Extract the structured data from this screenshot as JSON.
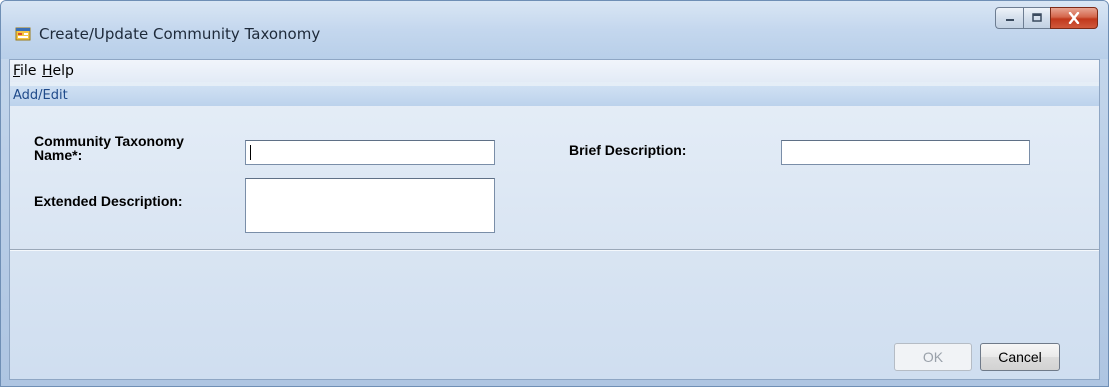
{
  "window": {
    "title": "Create/Update Community Taxonomy",
    "icon": "form-icon",
    "controls": {
      "minimize": "minimize-icon",
      "maximize": "maximize-icon",
      "close": "close-icon"
    }
  },
  "menu": {
    "file": {
      "underlined": "F",
      "rest": "ile"
    },
    "help": {
      "underlined": "H",
      "rest": "elp"
    }
  },
  "section": {
    "header": "Add/Edit"
  },
  "form": {
    "name_label_line1": "Community Taxonomy",
    "name_label_line2": "Name*:",
    "name_value": "",
    "brief_label": "Brief Description:",
    "brief_value": "",
    "extended_label": "Extended Description:",
    "extended_value": ""
  },
  "buttons": {
    "ok": "OK",
    "cancel": "Cancel"
  },
  "colors": {
    "window_bg": "#c9dbee",
    "group_header_text": "#1f4a8a",
    "close_button": "#c1381c"
  }
}
